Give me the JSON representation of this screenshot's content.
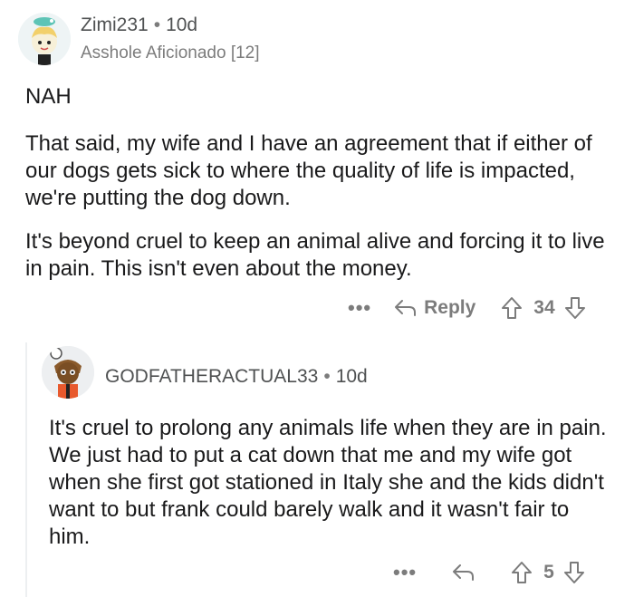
{
  "comment": {
    "username": "Zimi231",
    "separator": "•",
    "age": "10d",
    "flair": "Asshole Aficionado [12]",
    "paragraphs": [
      "NAH",
      "That said, my wife and I have an agreement that if either of our dogs gets sick to where the quality of life is impacted, we're putting the dog down.",
      "It's beyond cruel to keep an animal alive and forcing it to live in pain. This isn't even about the money."
    ],
    "actions": {
      "more": "•••",
      "reply_label": "Reply",
      "score": "34"
    }
  },
  "reply": {
    "username": "GODFATHERACTUAL33",
    "separator": "•",
    "age": "10d",
    "paragraphs": [
      "It's cruel to prolong any animals life when they are in pain. We just had to put a cat down that me and my wife got when she first got stationed in Italy she and the kids didn't want to but frank could barely walk and it wasn't fair to him."
    ],
    "actions": {
      "more": "•••",
      "score": "5"
    }
  },
  "icons": {
    "reply": "reply-arrow-icon",
    "upvote": "upvote-arrow-icon",
    "downvote": "downvote-arrow-icon",
    "more": "more-options-icon"
  },
  "colors": {
    "text": "#1a1a1b",
    "meta": "#7c7c7c",
    "thread_line": "#edeff1"
  }
}
